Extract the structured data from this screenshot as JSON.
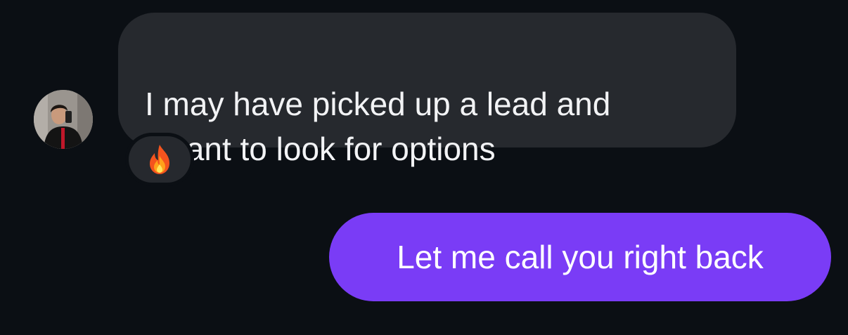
{
  "conversation": {
    "incoming": {
      "text": "I may have picked up a lead and\nI want to look for options",
      "avatar_icon": "user-photo-avatar",
      "reaction": {
        "emoji": "🔥",
        "icon": "fire-icon"
      }
    },
    "outgoing": {
      "text": "Let me call you right back"
    }
  },
  "colors": {
    "background": "#0b0f14",
    "incoming_bubble": "#26292e",
    "outgoing_bubble": "#7a3cf6",
    "text": "#f2f3f5"
  }
}
